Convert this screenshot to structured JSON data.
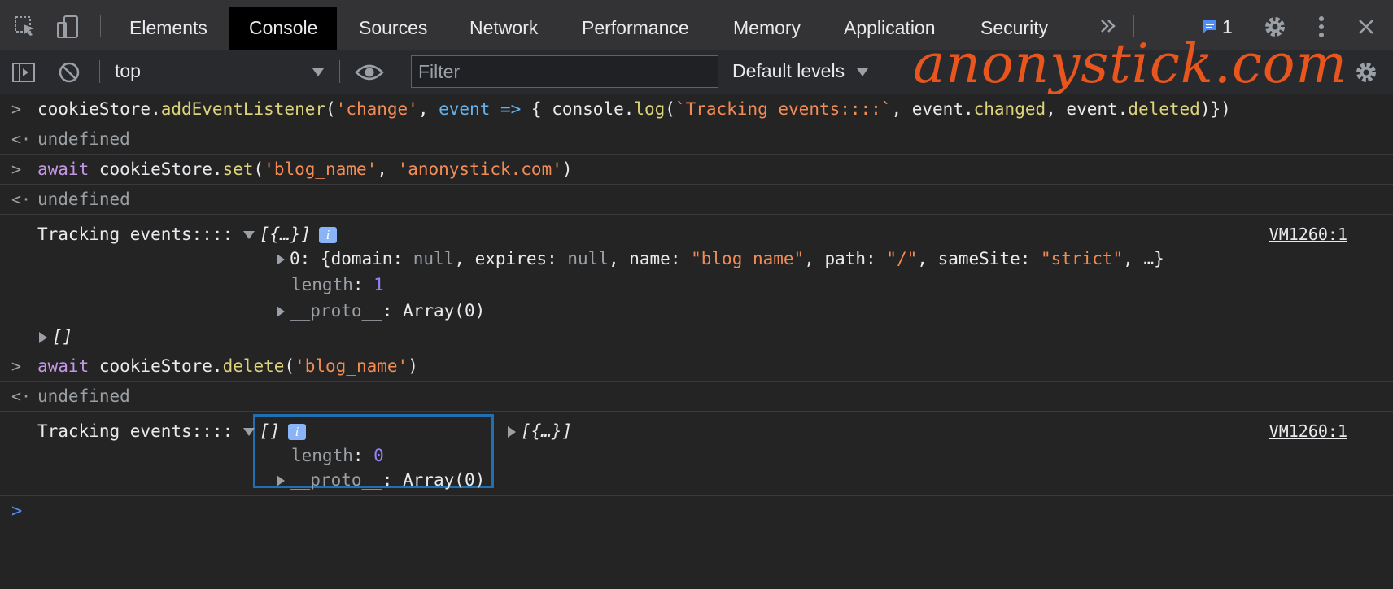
{
  "tabs": [
    "Elements",
    "Console",
    "Sources",
    "Network",
    "Performance",
    "Memory",
    "Application",
    "Security"
  ],
  "active_tab": "Console",
  "issues_count": "1",
  "toolbar": {
    "context": "top",
    "filter_placeholder": "Filter",
    "levels": "Default levels"
  },
  "watermark": "anonystick.com",
  "console": {
    "cmd1": {
      "a": "cookieStore.",
      "b": "addEventListener",
      "c": "(",
      "d": "'change'",
      "e": ", ",
      "f": "event",
      "g": " => ",
      "h": "{ console.",
      "i": "log",
      "j": "(",
      "k": "`Tracking events::::`",
      "l": ", event.",
      "m": "changed",
      "n": ", event.",
      "o": "deleted",
      "p": ")})"
    },
    "result1": "undefined",
    "cmd2": {
      "kw": "await",
      "a": " cookieStore.",
      "b": "set",
      "c": "(",
      "d": "'blog_name'",
      "e": ", ",
      "f": "'anonystick.com'",
      "g": ")"
    },
    "result2": "undefined",
    "log1": {
      "label": "Tracking events:::: ",
      "arr": "[{…}]",
      "info": "i",
      "source": "VM1260:1",
      "item0_key": "0",
      "item0_pre": ": {domain: ",
      "item0_null1": "null",
      "item0_mid1": ", expires: ",
      "item0_null2": "null",
      "item0_mid2": ", name: ",
      "item0_name": "\"blog_name\"",
      "item0_mid3": ", path: ",
      "item0_path": "\"/\"",
      "item0_mid4": ", sameSite: ",
      "item0_same": "\"strict\"",
      "item0_end": ", …}",
      "length_key": "length",
      "length_val": "1",
      "proto_key": "__proto__",
      "proto_val": ": Array(0)",
      "empty_arr": "[]"
    },
    "cmd3": {
      "kw": "await",
      "a": " cookieStore.",
      "b": "delete",
      "c": "(",
      "d": "'blog_name'",
      "e": ")"
    },
    "result3": "undefined",
    "log2": {
      "label": "Tracking events:::: ",
      "arr": "[]",
      "info": "i",
      "arr2": "[{…}]",
      "source": "VM1260:1",
      "length_key": "length",
      "length_val": "0",
      "proto_key": "__proto__",
      "proto_val": ": Array(0)"
    }
  }
}
